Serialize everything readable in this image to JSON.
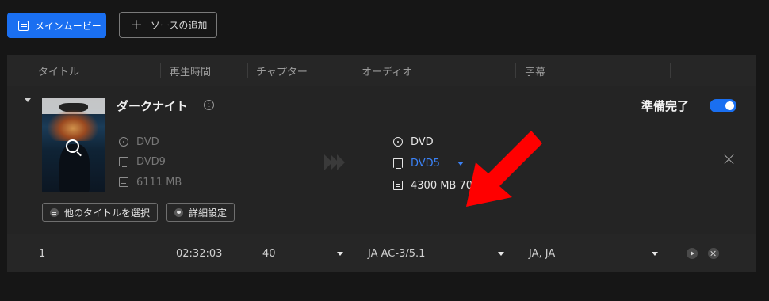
{
  "toolbar": {
    "main_movie_label": "メインムービー",
    "add_source_label": "ソースの追加"
  },
  "columns": {
    "title": "タイトル",
    "duration": "再生時間",
    "chapter": "チャプター",
    "audio": "オーディオ",
    "subtitle": "字幕"
  },
  "item": {
    "title": "ダークナイト",
    "info_glyph": "i",
    "source": {
      "type": "DVD",
      "format": "DVD9",
      "size": "6111 MB"
    },
    "output": {
      "type": "DVD",
      "format": "DVD5",
      "size": "4300 MB 70%"
    },
    "status_label": "準備完了",
    "status_toggle_on": true,
    "select_other_titles_label": "他のタイトルを選択",
    "advanced_settings_label": "詳細設定"
  },
  "row": {
    "title": "1",
    "duration": "02:32:03",
    "chapter": "40",
    "audio": "JA  AC-3/5.1",
    "subtitle": "JA, JA"
  },
  "colors": {
    "accent": "#1a6ff1",
    "arrow": "#ff0000",
    "panel": "#242424",
    "background": "#161616"
  }
}
